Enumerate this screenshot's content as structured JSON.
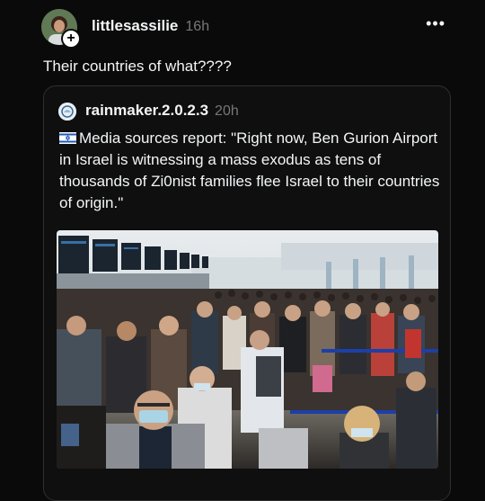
{
  "post": {
    "username": "littlesassilie",
    "time": "16h",
    "text": "Their countries of what????",
    "follow_glyph": "+",
    "more_glyph": "•••"
  },
  "quote": {
    "username": "rainmaker.2.0.2.3",
    "time": "20h",
    "flag_icon": "israel-flag-icon",
    "text": "Media sources report: \"Right now, Ben Gurion Airport in Israel is witnessing a mass exodus as tens of thousands of Zi0nist families flee Israel to their countries of origin.\""
  },
  "colors": {
    "background": "#0a0a0a",
    "text": "#f3f5f7",
    "muted": "#777777",
    "card_border": "#2f2f2f"
  }
}
